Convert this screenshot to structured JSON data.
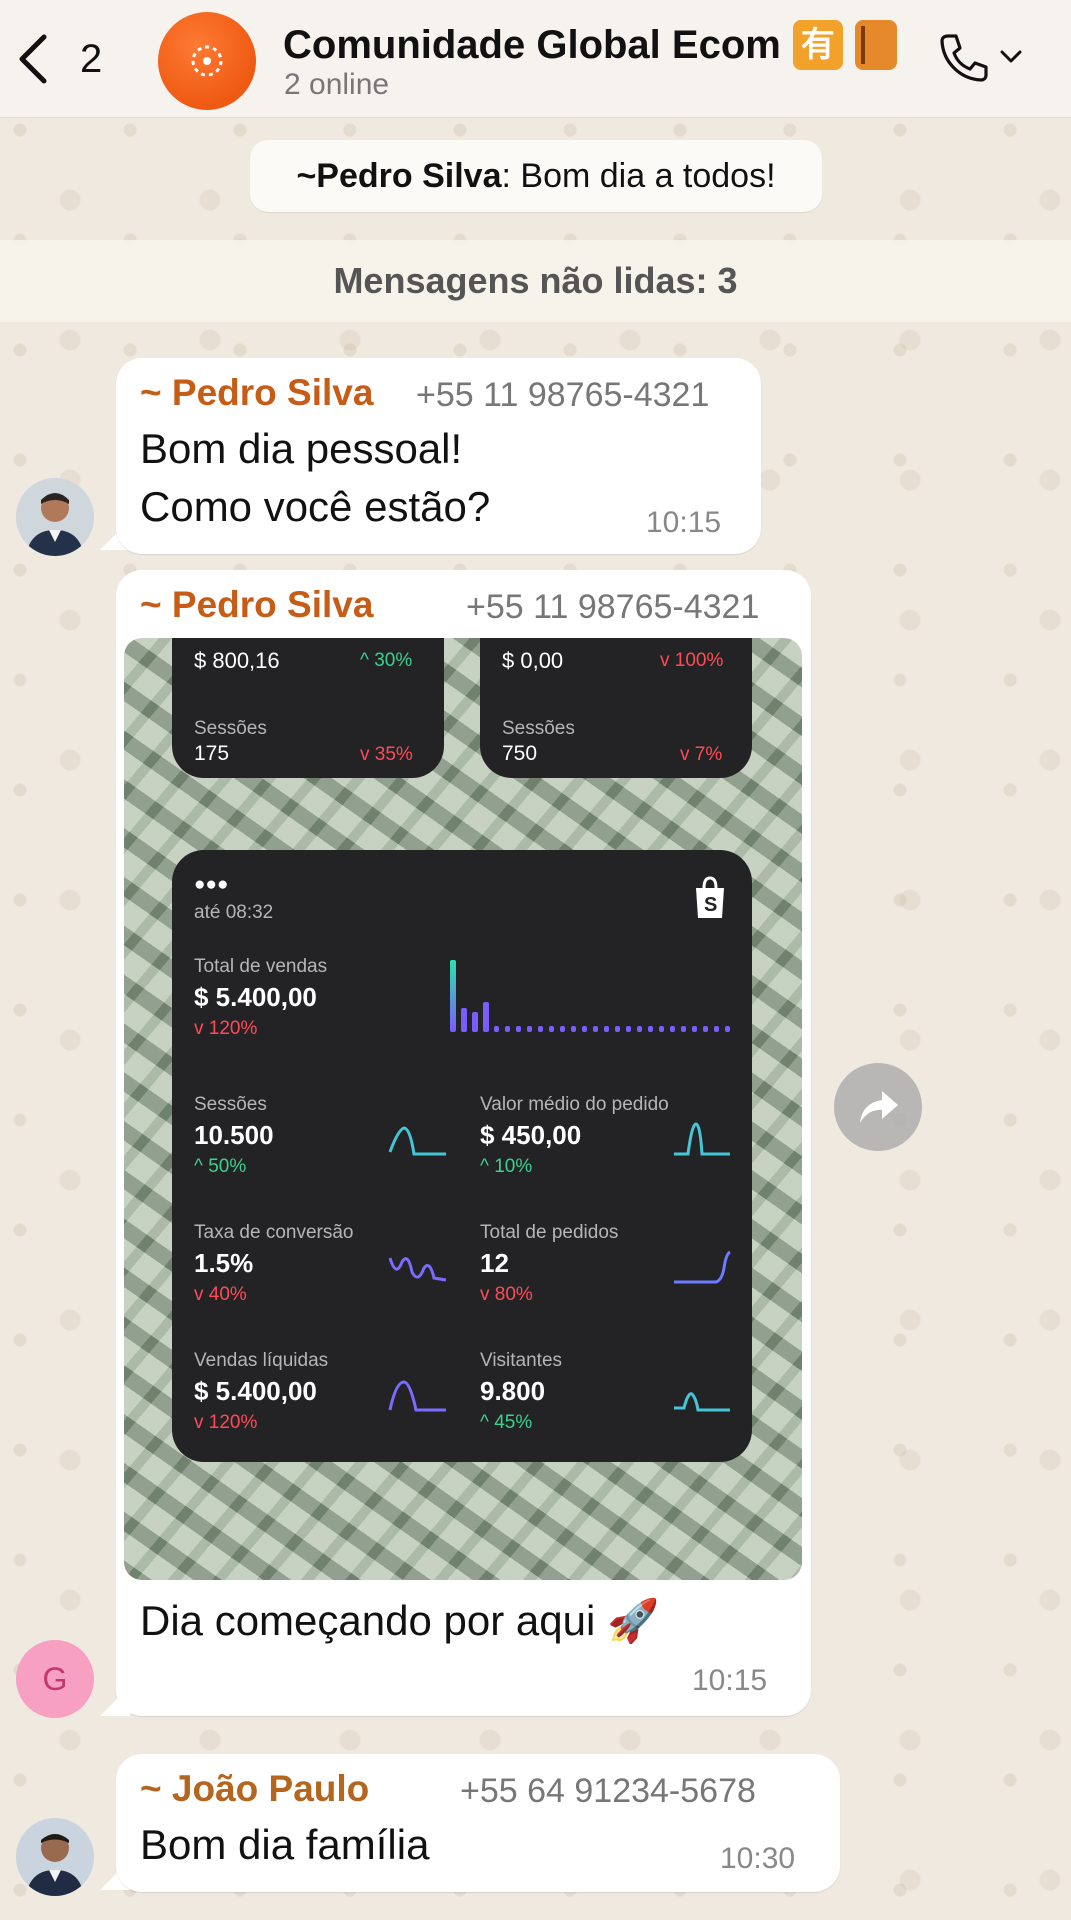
{
  "header": {
    "back_count": "2",
    "group_name": "Comunidade Global Ecom",
    "emoji_1": "有",
    "status": "2 online"
  },
  "system_message": {
    "author": "~Pedro Silva",
    "text": ": Bom dia a todos!"
  },
  "unread_label": "Mensagens não lidas: 3",
  "messages": [
    {
      "sender": "~ Pedro Silva",
      "phone": "+55 11 98765-4321",
      "line1": "Bom dia pessoal!",
      "line2": "Como você estão?",
      "time": "10:15"
    },
    {
      "sender": "~ Pedro Silva",
      "phone": "+55 11 98765-4321",
      "caption": "Dia começando por aqui 🚀",
      "time": "10:15",
      "avatar_letter": "G"
    },
    {
      "sender": "~ João Paulo",
      "phone": "+55 64 91234-5678",
      "text": "Bom dia família",
      "time": "10:30"
    }
  ],
  "dashboard": {
    "top_left": {
      "value": "$ 800,16",
      "change": "30%",
      "sess_label": "Sessões",
      "sess_value": "175",
      "sess_change": "35%"
    },
    "top_right": {
      "value": "$ 0,00",
      "change": "100%",
      "sess_label": "Sessões",
      "sess_value": "750",
      "sess_change": "7%"
    },
    "main": {
      "status": "●●●",
      "time": "até 08:32",
      "total_label": "Total de vendas",
      "total_value": "$ 5.400,00",
      "total_change": "120%",
      "sessions_label": "Sessões",
      "sessions_value": "10.500",
      "sessions_change": "50%",
      "avg_label": "Valor médio do pedido",
      "avg_value": "$ 450,00",
      "avg_change": "10%",
      "conv_label": "Taxa de conversão",
      "conv_value": "1.5%",
      "conv_change": "40%",
      "orders_label": "Total de pedidos",
      "orders_value": "12",
      "orders_change": "80%",
      "net_label": "Vendas líquidas",
      "net_value": "$ 5.400,00",
      "net_change": "120%",
      "visitors_label": "Visitantes",
      "visitors_value": "9.800",
      "visitors_change": "45%"
    }
  },
  "colors": {
    "sender_orange": "#c65c15",
    "up": "#3bd18f",
    "down": "#ff4b55"
  }
}
